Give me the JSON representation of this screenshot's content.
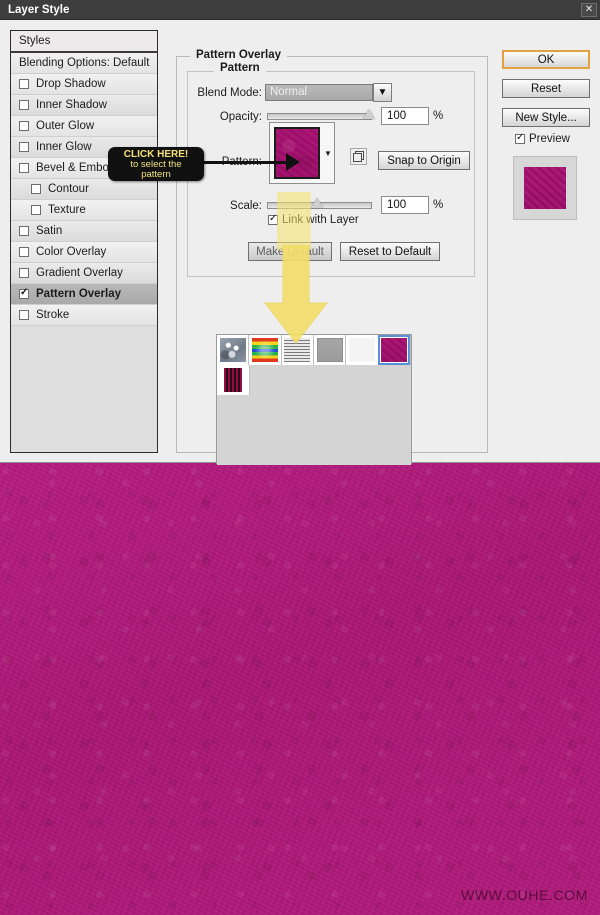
{
  "window": {
    "title": "Layer Style",
    "close_label": "✕"
  },
  "styles_panel": {
    "header": "Styles",
    "items": [
      {
        "label": "Blending Options: Default",
        "checkbox": false,
        "indent": false,
        "selected": false,
        "has_checkbox": false
      },
      {
        "label": "Drop Shadow",
        "checkbox": false,
        "indent": false,
        "selected": false,
        "has_checkbox": true
      },
      {
        "label": "Inner Shadow",
        "checkbox": false,
        "indent": false,
        "selected": false,
        "has_checkbox": true
      },
      {
        "label": "Outer Glow",
        "checkbox": false,
        "indent": false,
        "selected": false,
        "has_checkbox": true
      },
      {
        "label": "Inner Glow",
        "checkbox": false,
        "indent": false,
        "selected": false,
        "has_checkbox": true
      },
      {
        "label": "Bevel & Emboss",
        "checkbox": false,
        "indent": false,
        "selected": false,
        "has_checkbox": true
      },
      {
        "label": "Contour",
        "checkbox": false,
        "indent": true,
        "selected": false,
        "has_checkbox": true
      },
      {
        "label": "Texture",
        "checkbox": false,
        "indent": true,
        "selected": false,
        "has_checkbox": true
      },
      {
        "label": "Satin",
        "checkbox": false,
        "indent": false,
        "selected": false,
        "has_checkbox": true
      },
      {
        "label": "Color Overlay",
        "checkbox": false,
        "indent": false,
        "selected": false,
        "has_checkbox": true
      },
      {
        "label": "Gradient Overlay",
        "checkbox": false,
        "indent": false,
        "selected": false,
        "has_checkbox": true
      },
      {
        "label": "Pattern Overlay",
        "checkbox": true,
        "indent": false,
        "selected": true,
        "has_checkbox": true
      },
      {
        "label": "Stroke",
        "checkbox": false,
        "indent": false,
        "selected": false,
        "has_checkbox": true
      }
    ]
  },
  "pattern_overlay": {
    "group_legend": "Pattern Overlay",
    "subgroup_legend": "Pattern",
    "blend_mode_label": "Blend Mode:",
    "blend_mode_value": "Normal",
    "opacity_label": "Opacity:",
    "opacity_value": "100",
    "opacity_unit": "%",
    "pattern_label": "Pattern:",
    "snap_to_origin_label": "Snap to Origin",
    "scale_label": "Scale:",
    "scale_value": "100",
    "scale_unit": "%",
    "link_with_layer_label": "Link with Layer",
    "link_with_layer_checked": true,
    "make_default_label": "Make Default",
    "reset_to_default_label": "Reset to Default"
  },
  "swatches": {
    "row1": [
      {
        "name": "bubbles-pattern",
        "style": "sw-bubbles",
        "selected": false
      },
      {
        "name": "rainbow-pattern",
        "style": "sw-rainbow",
        "selected": false
      },
      {
        "name": "lines-pattern",
        "style": "sw-lines",
        "selected": false
      },
      {
        "name": "gray-pattern",
        "style": "sw-gray",
        "selected": false
      },
      {
        "name": "white-pattern",
        "style": "sw-white",
        "selected": false
      },
      {
        "name": "magenta-pattern",
        "style": "sw-magenta",
        "selected": true
      }
    ],
    "row2": [
      {
        "name": "stripe-pattern",
        "style": "sw-stripe",
        "selected": false
      }
    ]
  },
  "buttons": {
    "ok": "OK",
    "reset": "Reset",
    "new_style": "New Style...",
    "preview_label": "Preview",
    "preview_checked": true
  },
  "annotation": {
    "line1": "CLICK HERE!",
    "line2": "to select the",
    "line3": "pattern"
  },
  "canvas": {
    "watermark": "WWW.OUHE.COM",
    "fill_color": "#b0197a"
  }
}
